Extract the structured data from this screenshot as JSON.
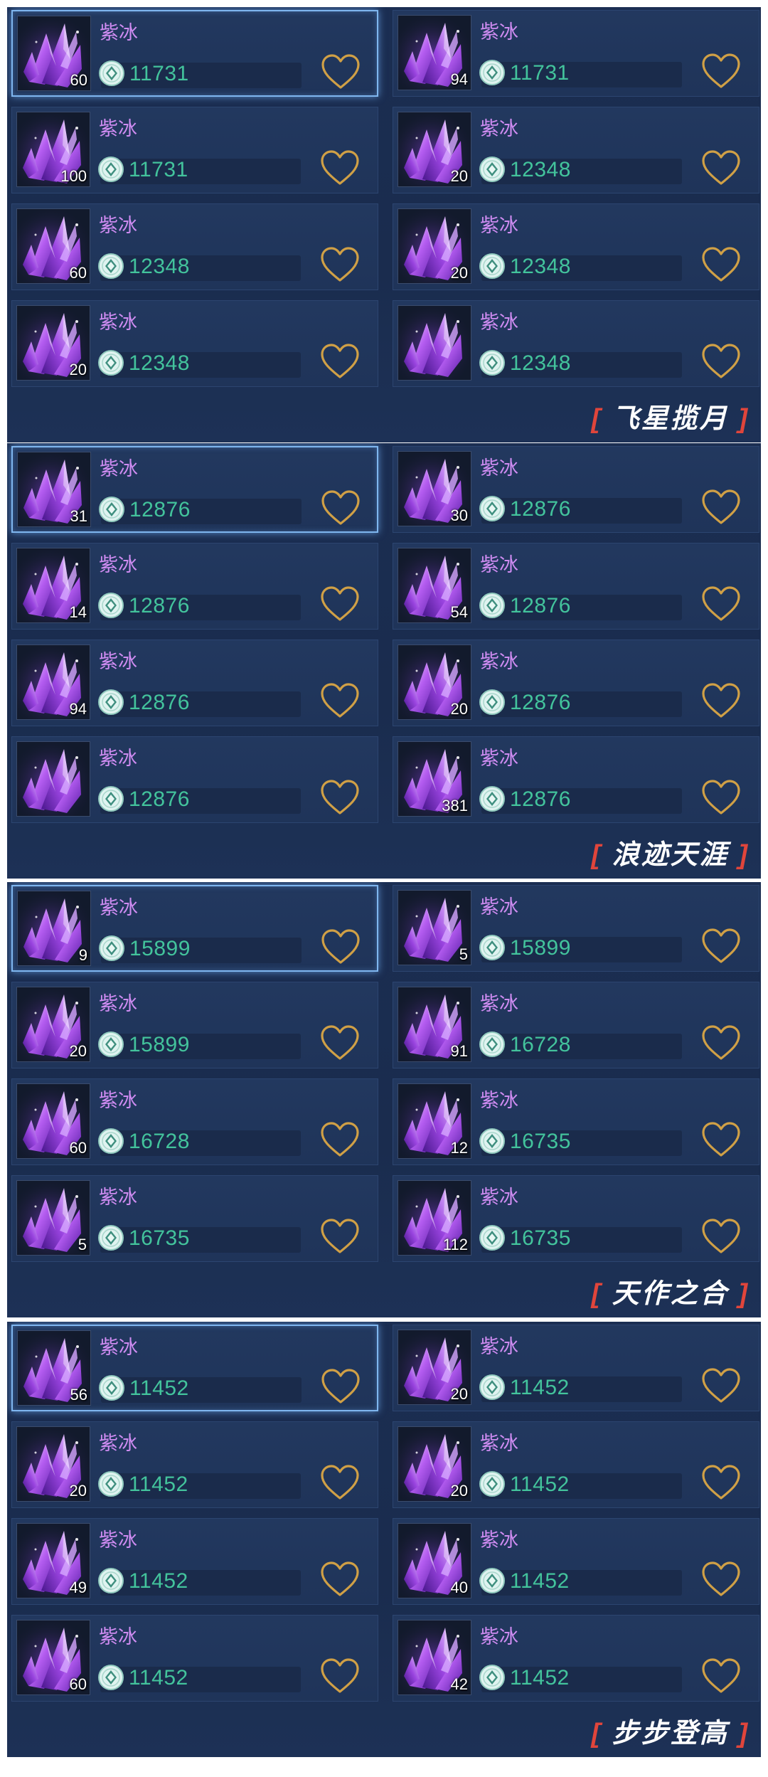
{
  "item_name": "紫冰",
  "colors": {
    "name": "#cf8cf2",
    "price": "#43c39c",
    "bracket": "#e0453b",
    "heart": "#d0a046",
    "selected_border": "#7fb6ef"
  },
  "icons": {
    "item": "purple-crystal-icon",
    "currency": "jade-coin-icon",
    "favorite": "heart-icon"
  },
  "panels": [
    {
      "caption": "飞星揽月",
      "items": [
        {
          "qty": "60",
          "price": "11731",
          "selected": true
        },
        {
          "qty": "94",
          "price": "11731"
        },
        {
          "qty": "100",
          "price": "11731"
        },
        {
          "qty": "20",
          "price": "12348"
        },
        {
          "qty": "60",
          "price": "12348"
        },
        {
          "qty": "20",
          "price": "12348"
        },
        {
          "qty": "20",
          "price": "12348"
        },
        {
          "qty": "",
          "price": "12348"
        }
      ]
    },
    {
      "caption": "浪迹天涯",
      "items": [
        {
          "qty": "31",
          "price": "12876",
          "selected": true
        },
        {
          "qty": "30",
          "price": "12876"
        },
        {
          "qty": "14",
          "price": "12876"
        },
        {
          "qty": "54",
          "price": "12876"
        },
        {
          "qty": "94",
          "price": "12876"
        },
        {
          "qty": "20",
          "price": "12876"
        },
        {
          "qty": "",
          "price": "12876"
        },
        {
          "qty": "381",
          "price": "12876"
        }
      ]
    },
    {
      "caption": "天作之合",
      "items": [
        {
          "qty": "9",
          "price": "15899",
          "selected": true
        },
        {
          "qty": "5",
          "price": "15899"
        },
        {
          "qty": "20",
          "price": "15899"
        },
        {
          "qty": "91",
          "price": "16728"
        },
        {
          "qty": "60",
          "price": "16728"
        },
        {
          "qty": "12",
          "price": "16735"
        },
        {
          "qty": "5",
          "price": "16735"
        },
        {
          "qty": "112",
          "price": "16735"
        }
      ]
    },
    {
      "caption": "步步登高",
      "items": [
        {
          "qty": "56",
          "price": "11452",
          "selected": true
        },
        {
          "qty": "20",
          "price": "11452"
        },
        {
          "qty": "20",
          "price": "11452"
        },
        {
          "qty": "20",
          "price": "11452"
        },
        {
          "qty": "49",
          "price": "11452"
        },
        {
          "qty": "40",
          "price": "11452"
        },
        {
          "qty": "60",
          "price": "11452"
        },
        {
          "qty": "42",
          "price": "11452"
        }
      ]
    }
  ]
}
